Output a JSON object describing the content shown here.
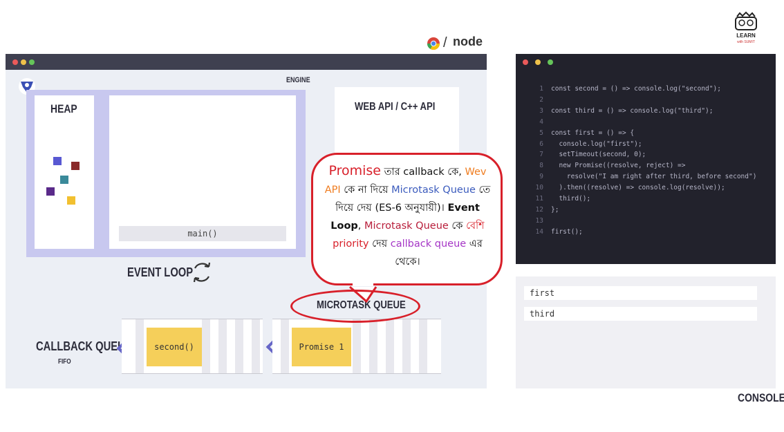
{
  "logos": {
    "node_text": "node"
  },
  "engine": {
    "engine_label": "ENGINE",
    "heap_label": "HEAP",
    "webapi_label": "WEB API / C++ API",
    "call_stack": [
      "main()"
    ],
    "event_loop_label": "EVENT LOOP",
    "callback_queue_label": "CALLBACK QUEUE",
    "callback_queue_sub": "FIFO",
    "microtask_queue_label": "MICROTASK QUEUE",
    "callback_queue_items": [
      "second()"
    ],
    "microtask_queue_items": [
      "Promise 1"
    ],
    "heap_colors": [
      "#5858d2",
      "#8a2a2a",
      "#3a8a9a",
      "#5a2a8a",
      "#f2c030"
    ]
  },
  "code": {
    "lines": [
      {
        "n": "1",
        "text": "const second = () => console.log(\"second\");"
      },
      {
        "n": "2",
        "text": ""
      },
      {
        "n": "3",
        "text": "const third = () => console.log(\"third\");"
      },
      {
        "n": "4",
        "text": ""
      },
      {
        "n": "5",
        "text": "const first = () => {"
      },
      {
        "n": "6",
        "text": "  console.log(\"first\");"
      },
      {
        "n": "7",
        "text": "  setTimeout(second, 0);"
      },
      {
        "n": "8",
        "text": "  new Promise((resolve, reject) =>"
      },
      {
        "n": "9",
        "text": "    resolve(\"I am right after third, before second\")"
      },
      {
        "n": "10",
        "text": "  ).then((resolve) => console.log(resolve));"
      },
      {
        "n": "11",
        "text": "  third();"
      },
      {
        "n": "12",
        "text": "};"
      },
      {
        "n": "13",
        "text": ""
      },
      {
        "n": "14",
        "text": "first();"
      }
    ]
  },
  "console": {
    "label": "CONSOLE",
    "output": [
      "first",
      "third"
    ]
  },
  "callout": {
    "p1": "Promise",
    "p2": " তার callback কে, ",
    "p3": "Wev API",
    "p4": " কে না দিয়ে ",
    "p5": "Microtask Queue",
    "p6": " তে দিয়ে দেয় (ES-6 অনুযায়ী)। ",
    "p7": "Event Loop",
    "p8": ", ",
    "p9": "Microtask Queue",
    "p10": " কে ",
    "p11": "বেশি priority",
    "p12": " দেয় ",
    "p13": "callback queue",
    "p14": " এর থেকে।"
  }
}
